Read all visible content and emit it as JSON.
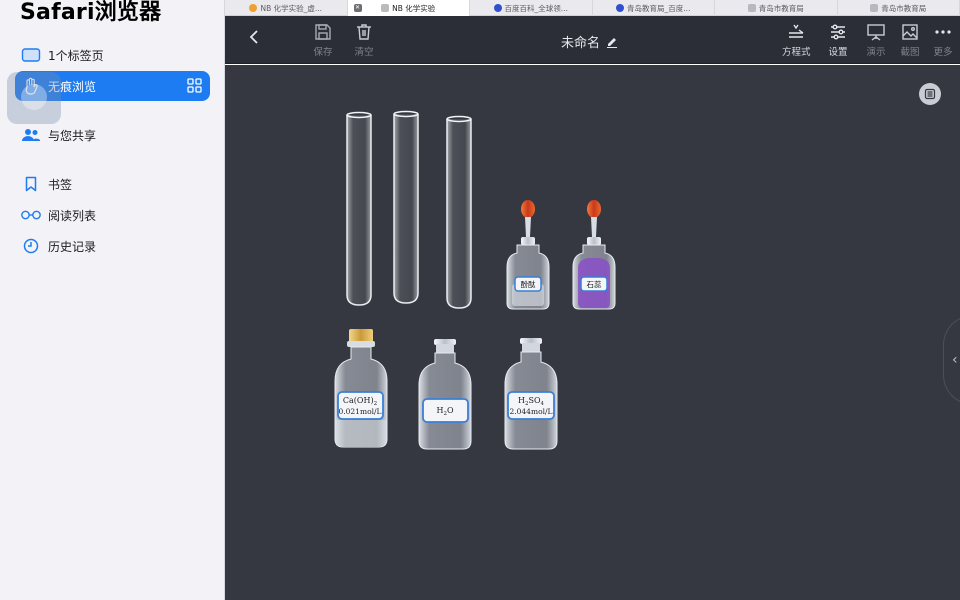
{
  "sidebar": {
    "title": "Safari浏览器",
    "items": [
      {
        "label": "1个标签页",
        "icon": "tabs-icon"
      },
      {
        "label": "无痕浏览",
        "icon": "private-hand-icon",
        "active": true
      },
      {
        "label": "与您共享",
        "icon": "shared-with-you-icon"
      },
      {
        "label": "书签",
        "icon": "bookmark-icon"
      },
      {
        "label": "阅读列表",
        "icon": "glasses-icon"
      },
      {
        "label": "历史记录",
        "icon": "clock-icon"
      }
    ]
  },
  "tabs": [
    {
      "label": "NB 化学实验_虚...",
      "favicon_color": "#f0a030"
    },
    {
      "label": "NB 化学实验",
      "active": true,
      "favicon_color": "#bbbbbb"
    },
    {
      "label": "百度百科_全球领...",
      "favicon_color": "#3050d0"
    },
    {
      "label": "青岛教育局_百度...",
      "favicon_color": "#3050d0"
    },
    {
      "label": "青岛市教育局",
      "favicon_color": "#b8b8c0"
    },
    {
      "label": "青岛市教育局",
      "favicon_color": "#b8b8c0"
    }
  ],
  "toolbar": {
    "save_label": "保存",
    "clear_label": "清空",
    "doc_title": "未命名",
    "equation_label": "方程式",
    "settings_label": "设置",
    "present_label": "演示",
    "screenshot_label": "截图",
    "more_label": "更多"
  },
  "canvas": {
    "dropper_bottles": [
      {
        "label": "酚酞",
        "liquid_color": "#d8dde6"
      },
      {
        "label": "石蕊",
        "liquid_color": "#8a4fc8"
      }
    ],
    "reagent_bottles": [
      {
        "formula": "Ca(OH)",
        "sub": "2",
        "conc": "0.021mol/L",
        "stopper": "gold"
      },
      {
        "formula": "H",
        "sub": "2",
        "formula_after": "O",
        "conc": "",
        "stopper": "glass"
      },
      {
        "formula": "H",
        "sub": "2",
        "formula_after": "SO",
        "sub2": "4",
        "conc": "2.044mol/L",
        "stopper": "glass"
      }
    ],
    "test_tube_count": 3
  }
}
